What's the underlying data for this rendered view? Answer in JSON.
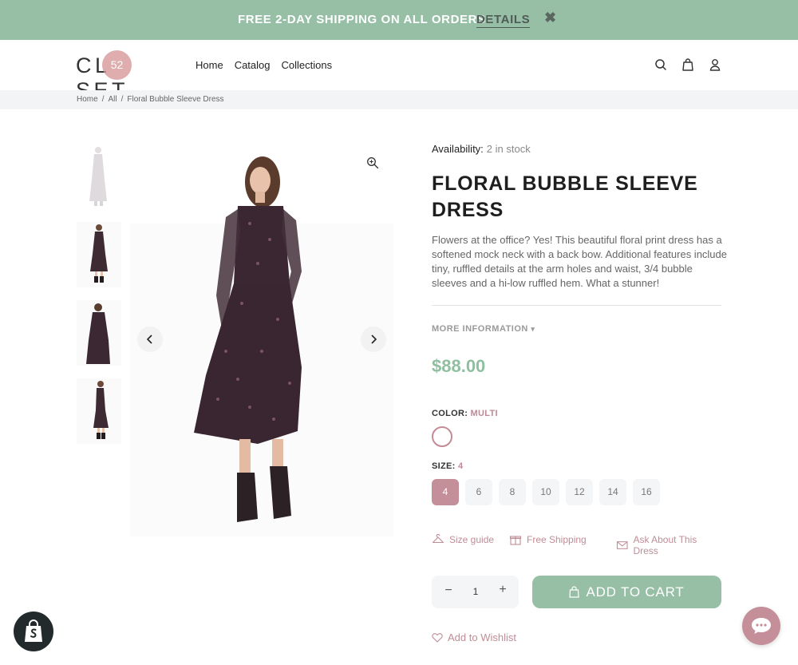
{
  "announcement": {
    "text": "FREE 2-DAY SHIPPING ON ALL ORDERS!",
    "link": "DETAILS",
    "close_icon": "close-icon"
  },
  "header": {
    "logo_left": "CL",
    "logo_right": "SET",
    "logo_badge": "52",
    "nav": [
      "Home",
      "Catalog",
      "Collections"
    ],
    "icons": [
      "search-icon",
      "bag-icon",
      "user-icon"
    ]
  },
  "breadcrumb": [
    "Home",
    "All",
    "Floral Bubble Sleeve Dress"
  ],
  "product": {
    "availability_label": "Availability:",
    "availability_value": "2 in stock",
    "title": "FLORAL BUBBLE SLEEVE DRESS",
    "description": "Flowers at the office? Yes! This beautiful floral print dress has a softened mock neck with a back bow. Additional features include tiny, ruffled details at the arm holes and waist, 3/4 bubble sleeves and a hi-low ruffled hem. What a stunner!",
    "more_info": "MORE INFORMATION",
    "more_info_caret": "▾",
    "price": "$88.00",
    "color_label": "COLOR:",
    "color_value": "MULTI",
    "size_label": "SIZE:",
    "size_value": "4",
    "sizes": [
      "4",
      "6",
      "8",
      "10",
      "12",
      "14",
      "16"
    ],
    "selected_size": "4",
    "links": {
      "size_guide": "Size guide",
      "free_shipping": "Free Shipping",
      "ask": "Ask About This Dress"
    },
    "quantity": "1",
    "qty_minus": "−",
    "qty_plus": "+",
    "add_to_cart": "ADD TO CART",
    "wishlist": "Add to Wishlist"
  },
  "colors": {
    "brand_green": "#97bfa6",
    "accent_rose": "#c58f9a",
    "price_green": "#8fbf9f"
  }
}
